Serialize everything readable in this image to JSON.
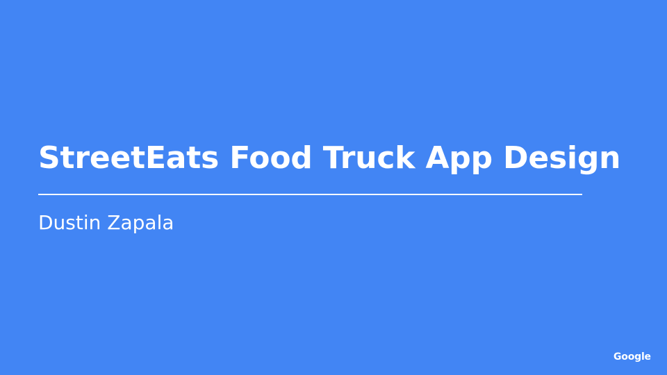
{
  "slide": {
    "title": "StreetEats Food Truck App Design",
    "subtitle": "Dustin Zapala",
    "brand": "Google",
    "background_color": "#4285F4",
    "text_color": "#FFFFFF"
  }
}
